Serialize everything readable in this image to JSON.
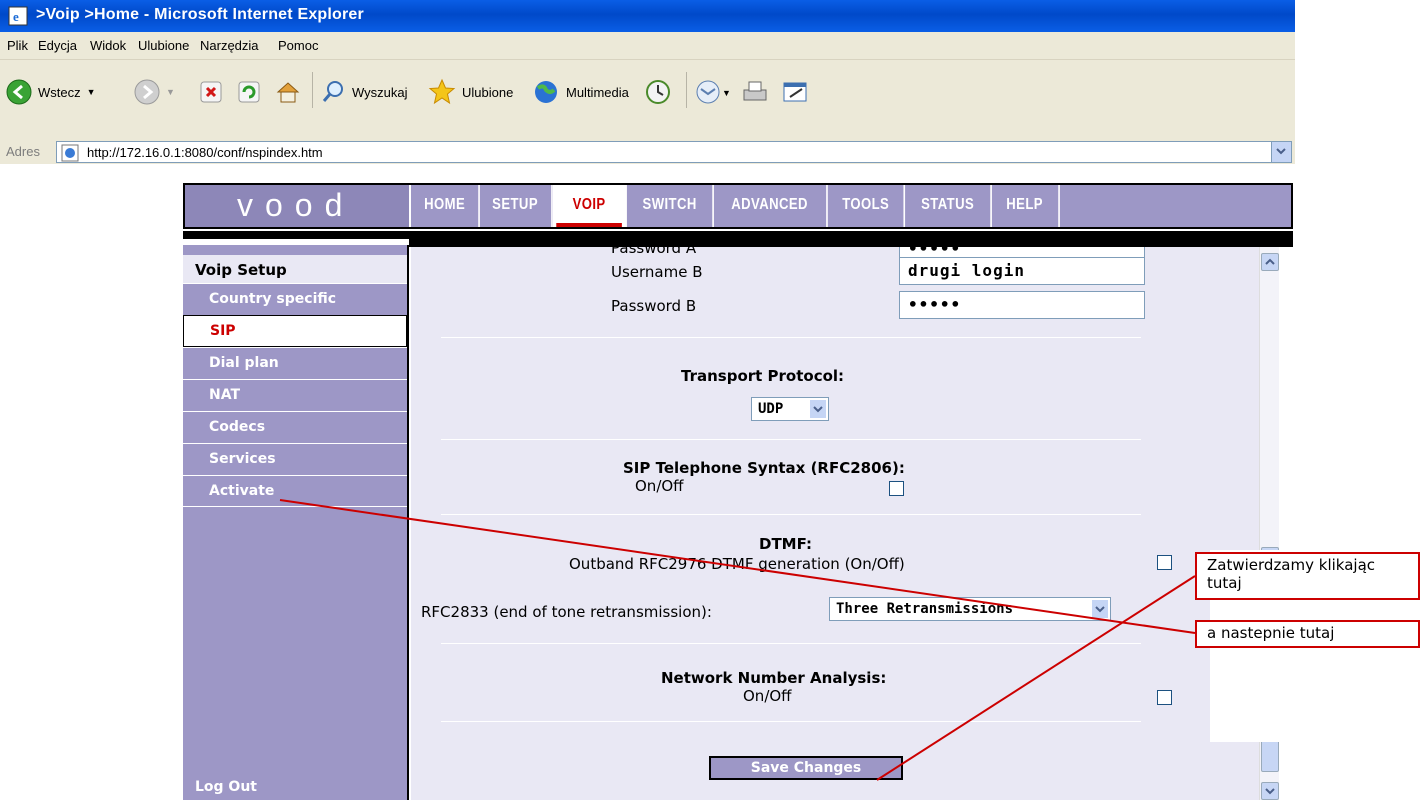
{
  "window": {
    "title": ">Voip >Home - Microsoft Internet Explorer"
  },
  "menu": [
    "Plik",
    "Edycja",
    "Widok",
    "Ulubione",
    "Narzędzia",
    "Pomoc"
  ],
  "toolbar": {
    "back": "Wstecz",
    "search": "Wyszukaj",
    "favorites": "Ulubione",
    "media": "Multimedia"
  },
  "address": {
    "label": "Adres",
    "url": "http://172.16.0.1:8080/conf/nspindex.htm"
  },
  "router": {
    "logo": "vood",
    "nav": [
      "HOME",
      "SETUP",
      "VOIP",
      "SWITCH",
      "ADVANCED",
      "TOOLS",
      "STATUS",
      "HELP"
    ],
    "active_nav": "VOIP",
    "sidebar": {
      "heading": "Voip Setup",
      "items": [
        "Country specific",
        "SIP",
        "Dial plan",
        "NAT",
        "Codecs",
        "Services",
        "Activate"
      ],
      "active_item": "SIP",
      "logout": "Log Out"
    },
    "form": {
      "password_a_label": "Password A",
      "password_a_value": "•••••",
      "username_b_label": "Username B",
      "username_b_value": "drugi login",
      "password_b_label": "Password B",
      "password_b_value": "•••••",
      "transport_title": "Transport Protocol:",
      "transport_value": "UDP",
      "sip_syntax_title": "SIP Telephone Syntax (RFC2806):",
      "sip_syntax_onoff": "On/Off",
      "dtmf_title": "DTMF:",
      "dtmf_outband": "Outband RFC2976 DTMF generation (On/Off)",
      "rfc2833_label": "RFC2833 (end of tone retransmission):",
      "rfc2833_value": "Three Retransmissions",
      "nna_title": "Network Number Analysis:",
      "nna_onoff": "On/Off",
      "save": "Save Changes"
    }
  },
  "annotations": {
    "note1_line1": "Zatwierdzamy klikając",
    "note1_line2": "tutaj",
    "note2": "a nastepnie tutaj",
    "color": "#cc0000"
  },
  "colors": {
    "nav_purple": "#9d97c6",
    "content_bg": "#e9e8f4",
    "active_red": "#cc0000",
    "ie_blue": "#0a5ee6"
  }
}
